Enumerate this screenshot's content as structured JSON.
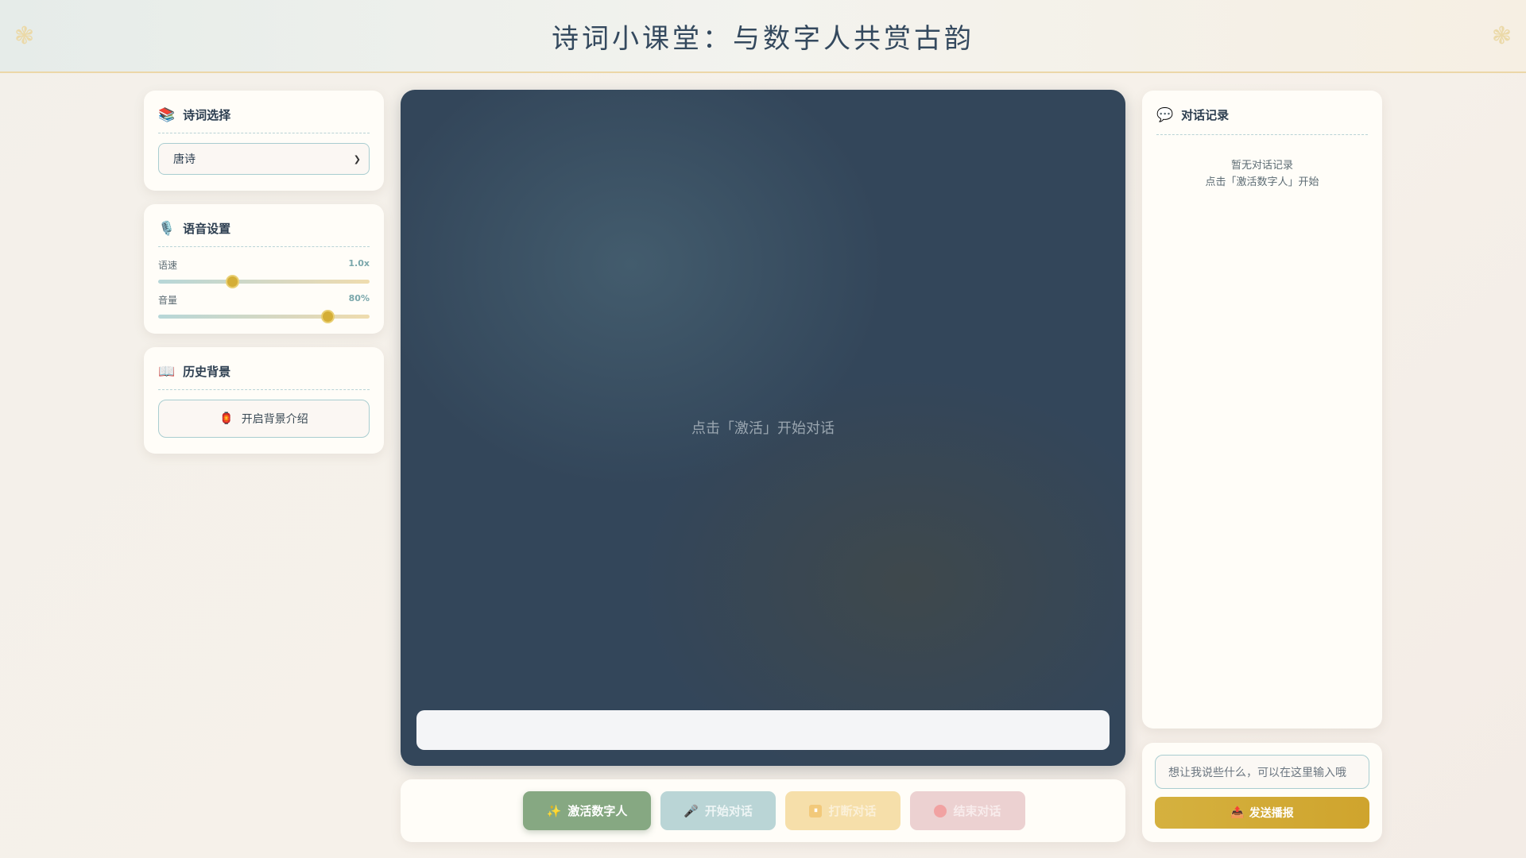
{
  "header": {
    "title": "诗词小课堂：与数字人共赏古韵",
    "ornament": "❃"
  },
  "poem_select": {
    "icon": "📚",
    "title": "诗词选择",
    "selected": "唐诗"
  },
  "voice": {
    "icon": "🎙️",
    "title": "语音设置",
    "speed": {
      "label": "语速",
      "value": "1.0x",
      "level": 0.35
    },
    "volume": {
      "label": "音量",
      "value": "80%",
      "level": 0.8
    }
  },
  "history": {
    "icon": "📖",
    "title": "历史背景",
    "button_icon": "🏮",
    "button_label": "开启背景介绍"
  },
  "stage": {
    "hint": "点击「激活」开始对话"
  },
  "controls": {
    "activate": {
      "icon": "✨",
      "label": "激活数字人"
    },
    "start": {
      "icon": "🎤",
      "label": "开始对话"
    },
    "interrupt": {
      "icon": "⏸",
      "label": "打断对话"
    },
    "end": {
      "label": "结束对话"
    }
  },
  "chat": {
    "icon": "💬",
    "title": "对话记录",
    "empty_line1": "暂无对话记录",
    "empty_line2": "点击「激活数字人」开始"
  },
  "input": {
    "placeholder": "想让我说些什么，可以在这里输入哦",
    "send_icon": "📤",
    "send_label": "发送播报"
  },
  "colors": {
    "accent_gold": "#d4ae37",
    "sage_green": "#86a882",
    "teal": "#a9cdd0",
    "stage_bg": "#33465a"
  }
}
